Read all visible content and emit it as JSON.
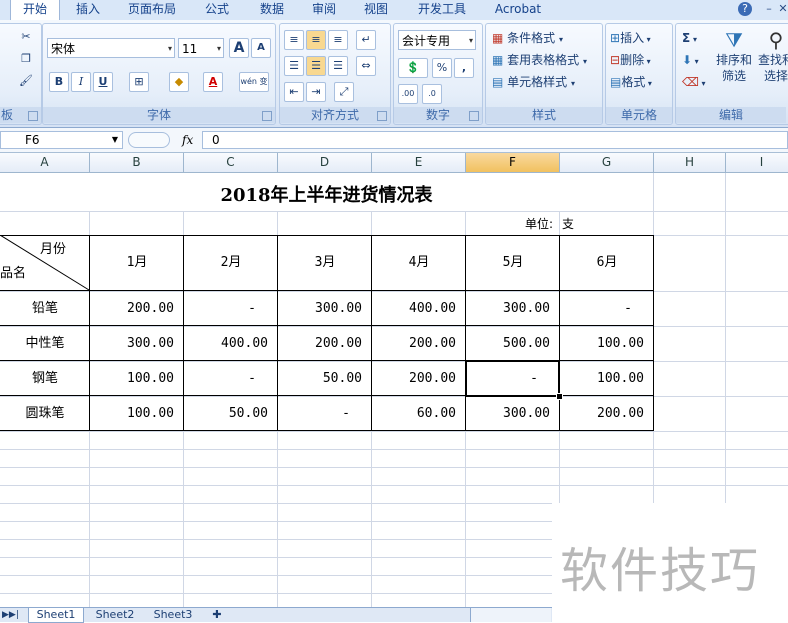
{
  "ribbon_tabs": [
    "开始",
    "插入",
    "页面布局",
    "公式",
    "数据",
    "审阅",
    "视图",
    "开发工具",
    "Acrobat"
  ],
  "ribbon": {
    "font_name": "宋体",
    "font_size": "11",
    "grow_font": "A",
    "shrink_font": "A",
    "bold": "B",
    "italic": "I",
    "underline": "U",
    "font_color_letter": "A",
    "phonetic": "wén 变",
    "number_format": "会计专用",
    "percent": "%",
    "comma": ",",
    "inc_decimal": ".00",
    "dec_decimal": ".0",
    "styles": [
      "条件格式",
      "套用表格格式",
      "单元格样式"
    ],
    "cells": [
      "插入",
      "删除",
      "格式"
    ],
    "sum": "Σ",
    "sort_filter": "排序和筛选",
    "sort_filter_1": "排序和",
    "sort_filter_2": "筛选",
    "find_select_1": "查找和",
    "find_select_2": "选择",
    "groups": {
      "clipboard": "板",
      "font": "字体",
      "alignment": "对齐方式",
      "number": "数字",
      "styles": "样式",
      "cells": "单元格",
      "editing": "编辑"
    }
  },
  "formula_bar": {
    "name_box": "F6",
    "fx": "fx",
    "content": "0"
  },
  "columns": [
    "A",
    "B",
    "C",
    "D",
    "E",
    "F",
    "G",
    "H",
    "I"
  ],
  "sheet": {
    "title": "2018年上半年进货情况表",
    "unit_label": "单位:",
    "unit_value": "支",
    "corner_top": "月份",
    "corner_bottom": "品名",
    "months": [
      "1月",
      "2月",
      "3月",
      "4月",
      "5月",
      "6月"
    ],
    "rows": [
      {
        "name": "铅笔",
        "values": [
          "200.00",
          "-",
          "300.00",
          "400.00",
          "300.00",
          "-"
        ]
      },
      {
        "name": "中性笔",
        "values": [
          "300.00",
          "400.00",
          "200.00",
          "200.00",
          "500.00",
          "100.00"
        ]
      },
      {
        "name": "钢笔",
        "values": [
          "100.00",
          "-",
          "50.00",
          "200.00",
          "-",
          "100.00"
        ]
      },
      {
        "name": "圆珠笔",
        "values": [
          "100.00",
          "50.00",
          "-",
          "60.00",
          "300.00",
          "200.00"
        ]
      }
    ]
  },
  "sheet_tabs": [
    "Sheet1",
    "Sheet2",
    "Sheet3"
  ],
  "watermark": "软件技巧",
  "colors": {
    "selected_header": "#f1c15f",
    "ribbon_bg": "#e3ecf8",
    "grid_line": "#d0d7e5"
  }
}
